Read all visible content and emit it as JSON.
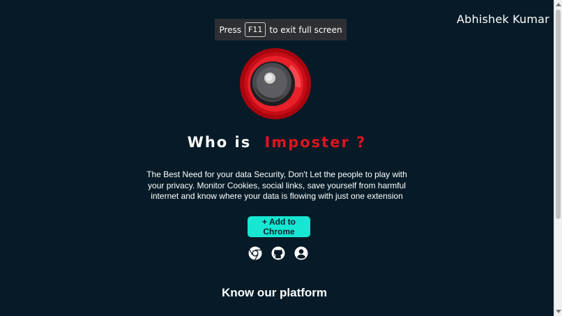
{
  "header": {
    "author_name": "Abhishek Kumar"
  },
  "fullscreen_toast": {
    "prefix": "Press",
    "key": "F11",
    "suffix": "to exit full screen"
  },
  "hero": {
    "title_prefix": "Who is",
    "title_highlight": "Imposter ?",
    "description": "The Best Need for your data Security, Don't Let the people to play with your privacy. Monitor Cookies, social links, save yourself from harmful internet and know where your data is flowing with just one extension",
    "cta_label": "+ Add to Chrome"
  },
  "social_icons": [
    {
      "name": "chrome-icon"
    },
    {
      "name": "github-icon"
    },
    {
      "name": "user-profile-icon"
    }
  ],
  "sections": {
    "platform_title": "Know our platform"
  },
  "colors": {
    "background": "#061b27",
    "accent_red": "#e0141e",
    "cta_teal": "#16e6d2",
    "text": "#ffffff"
  }
}
